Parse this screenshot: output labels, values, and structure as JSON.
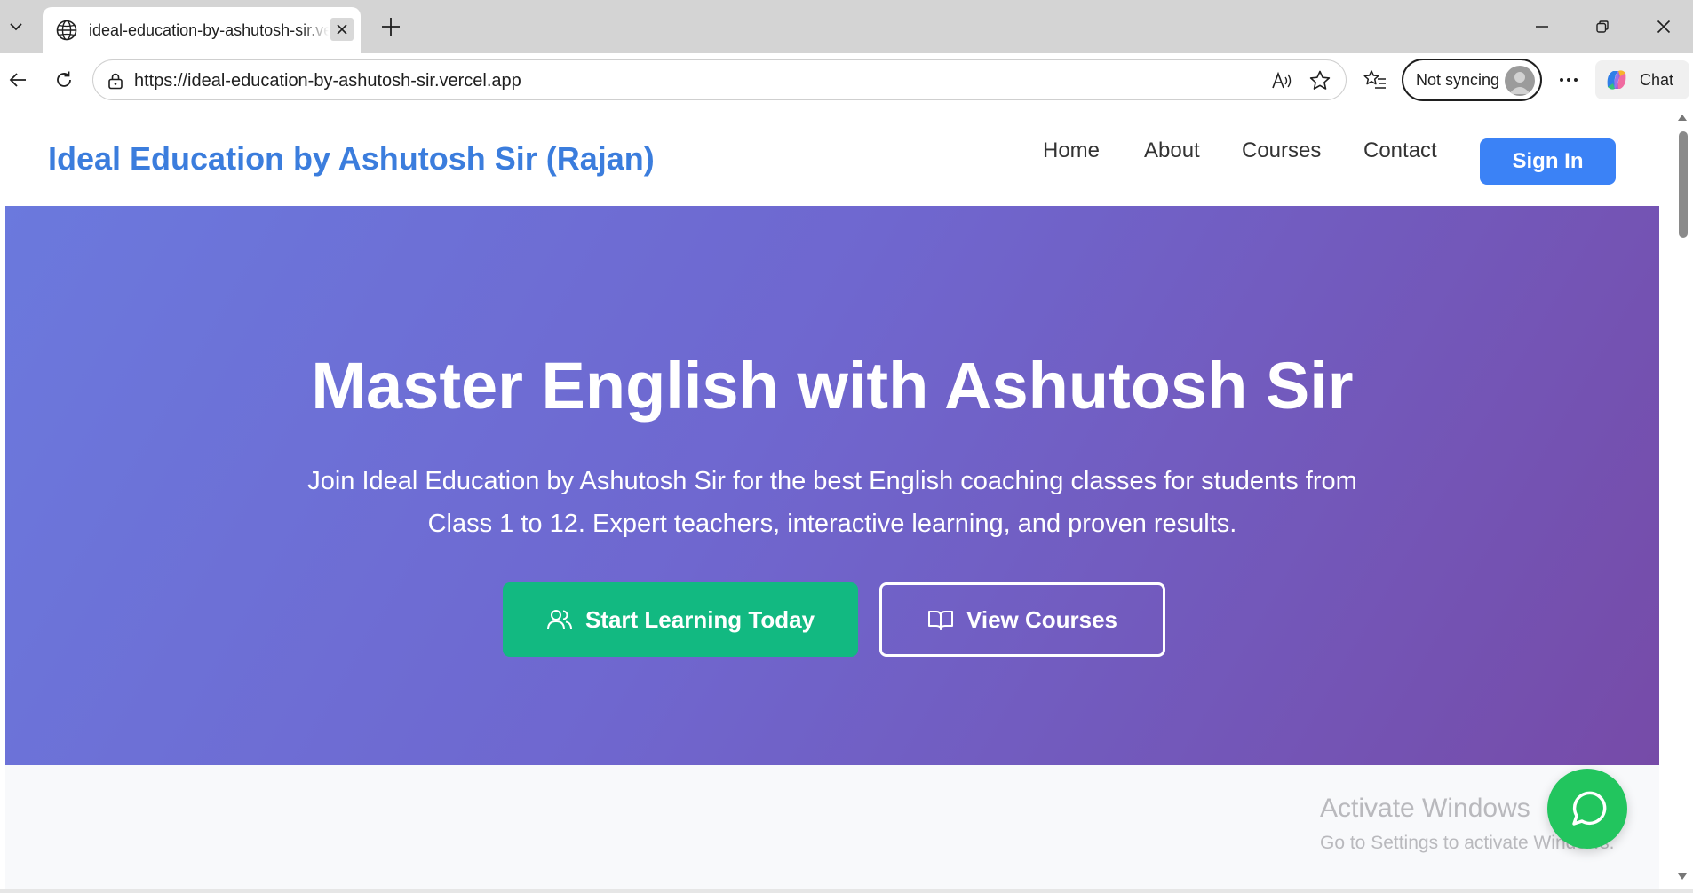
{
  "browser": {
    "tab": {
      "title": "ideal-education-by-ashutosh-sir.vercel.app",
      "icon": "globe-icon"
    },
    "address_bar": {
      "url": "https://ideal-education-by-ashutosh-sir.vercel.app"
    },
    "profile": {
      "sync_label": "Not syncing"
    },
    "chat_label": "Chat"
  },
  "site": {
    "brand": "Ideal Education by Ashutosh Sir (Rajan)",
    "nav": {
      "home": "Home",
      "about": "About",
      "courses": "Courses",
      "contact": "Contact"
    },
    "sign_in": "Sign In",
    "hero": {
      "title": "Master English with Ashutosh Sir",
      "subtitle": "Join Ideal Education by Ashutosh Sir for the best English coaching classes for students from Class 1 to 12. Expert teachers, interactive learning, and proven results.",
      "primary_cta": "Start Learning Today",
      "secondary_cta": "View Courses"
    }
  },
  "watermark": {
    "title": "Activate Windows",
    "subtitle": "Go to Settings to activate Windows."
  },
  "colors": {
    "brand": "#3b7ddd",
    "sign_in_bg": "#3b82f6",
    "primary_cta_bg": "#12b981",
    "hero_gradient_start": "#6b79dd",
    "hero_gradient_end": "#764ba8",
    "whatsapp": "#22c55e"
  }
}
